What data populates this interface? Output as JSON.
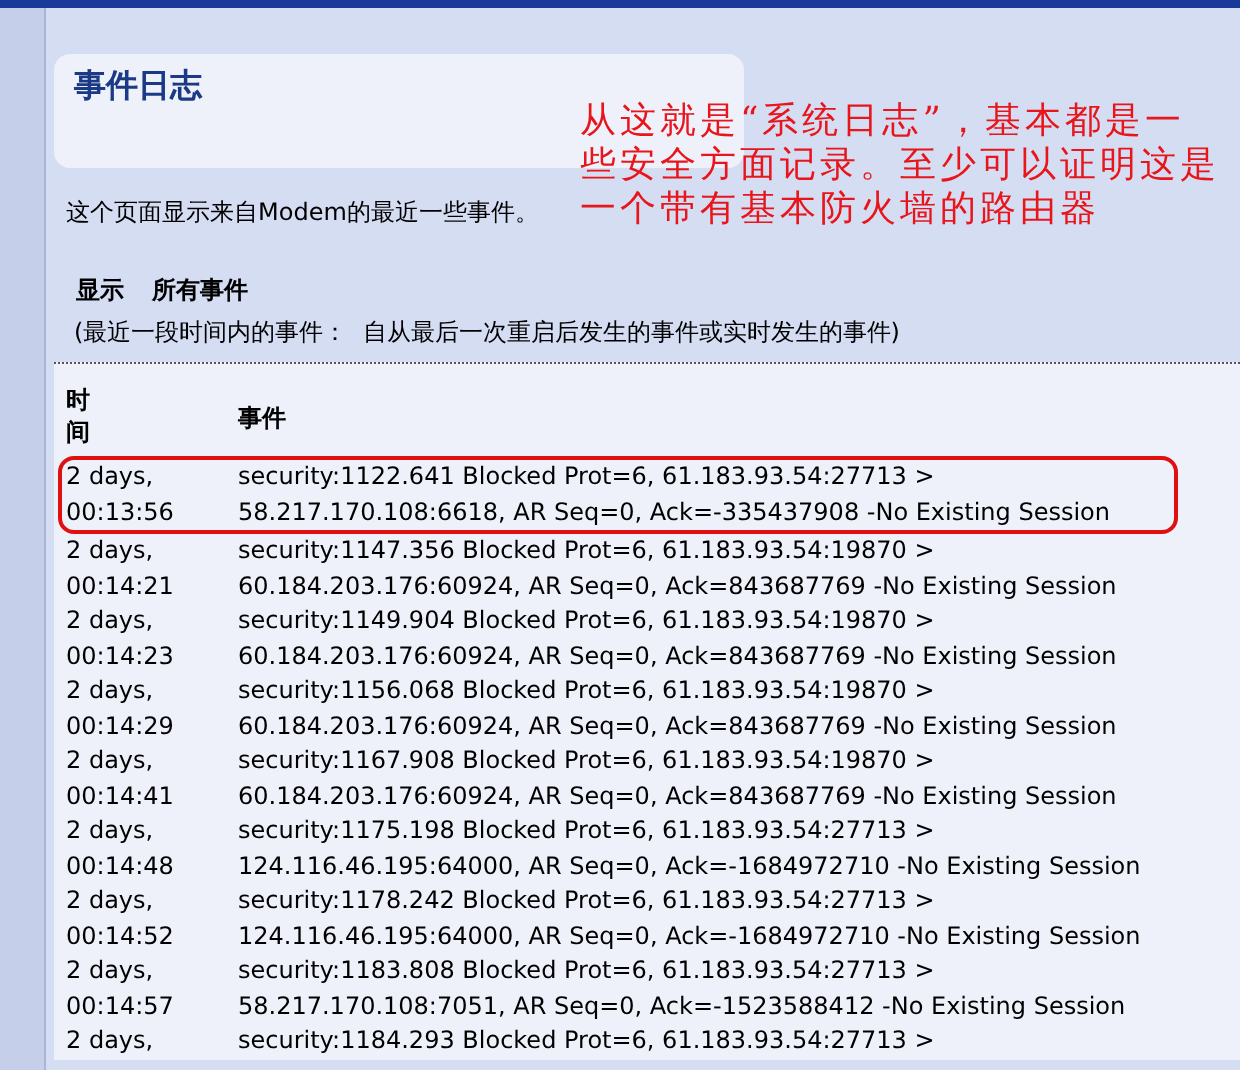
{
  "page": {
    "title": "事件日志",
    "description": "这个页面显示来自Modem的最近一些事件。"
  },
  "filter": {
    "label": "显示",
    "value": "所有事件",
    "note": "(最近一段时间内的事件：  自从最后一次重启后发生的事件或实时发生的事件)"
  },
  "table": {
    "columns": [
      "时间",
      "事件"
    ],
    "rows": [
      {
        "time": [
          "2 days,",
          "00:13:56"
        ],
        "event": [
          "security:1122.641 Blocked Prot=6, 61.183.93.54:27713 >",
          "58.217.170.108:6618, AR Seq=0, Ack=-335437908 -No Existing Session"
        ],
        "highlighted": true
      },
      {
        "time": [
          "2 days,",
          "00:14:21"
        ],
        "event": [
          "security:1147.356 Blocked Prot=6, 61.183.93.54:19870 >",
          "60.184.203.176:60924, AR Seq=0, Ack=843687769 -No Existing Session"
        ],
        "highlighted": false
      },
      {
        "time": [
          "2 days,",
          "00:14:23"
        ],
        "event": [
          "security:1149.904 Blocked Prot=6, 61.183.93.54:19870 >",
          "60.184.203.176:60924, AR Seq=0, Ack=843687769 -No Existing Session"
        ],
        "highlighted": false
      },
      {
        "time": [
          "2 days,",
          "00:14:29"
        ],
        "event": [
          "security:1156.068 Blocked Prot=6, 61.183.93.54:19870 >",
          "60.184.203.176:60924, AR Seq=0, Ack=843687769 -No Existing Session"
        ],
        "highlighted": false
      },
      {
        "time": [
          "2 days,",
          "00:14:41"
        ],
        "event": [
          "security:1167.908 Blocked Prot=6, 61.183.93.54:19870 >",
          "60.184.203.176:60924, AR Seq=0, Ack=843687769 -No Existing Session"
        ],
        "highlighted": false
      },
      {
        "time": [
          "2 days,",
          "00:14:48"
        ],
        "event": [
          "security:1175.198 Blocked Prot=6, 61.183.93.54:27713 >",
          "124.116.46.195:64000, AR Seq=0, Ack=-1684972710 -No Existing Session"
        ],
        "highlighted": false
      },
      {
        "time": [
          "2 days,",
          "00:14:52"
        ],
        "event": [
          "security:1178.242 Blocked Prot=6, 61.183.93.54:27713 >",
          "124.116.46.195:64000, AR Seq=0, Ack=-1684972710 -No Existing Session"
        ],
        "highlighted": false
      },
      {
        "time": [
          "2 days,",
          "00:14:57"
        ],
        "event": [
          "security:1183.808 Blocked Prot=6, 61.183.93.54:27713 >",
          "58.217.170.108:7051, AR Seq=0, Ack=-1523588412 -No Existing Session"
        ],
        "highlighted": false
      },
      {
        "time": [
          "2 days,"
        ],
        "event": [
          "security:1184.293 Blocked Prot=6, 61.183.93.54:27713 >"
        ],
        "highlighted": false
      }
    ]
  },
  "annotation": {
    "lines": [
      "从这就是“系统日志”，基本都是一",
      "些安全方面记录。至少可以证明这是",
      "一个带有基本防火墙的路由器"
    ]
  }
}
